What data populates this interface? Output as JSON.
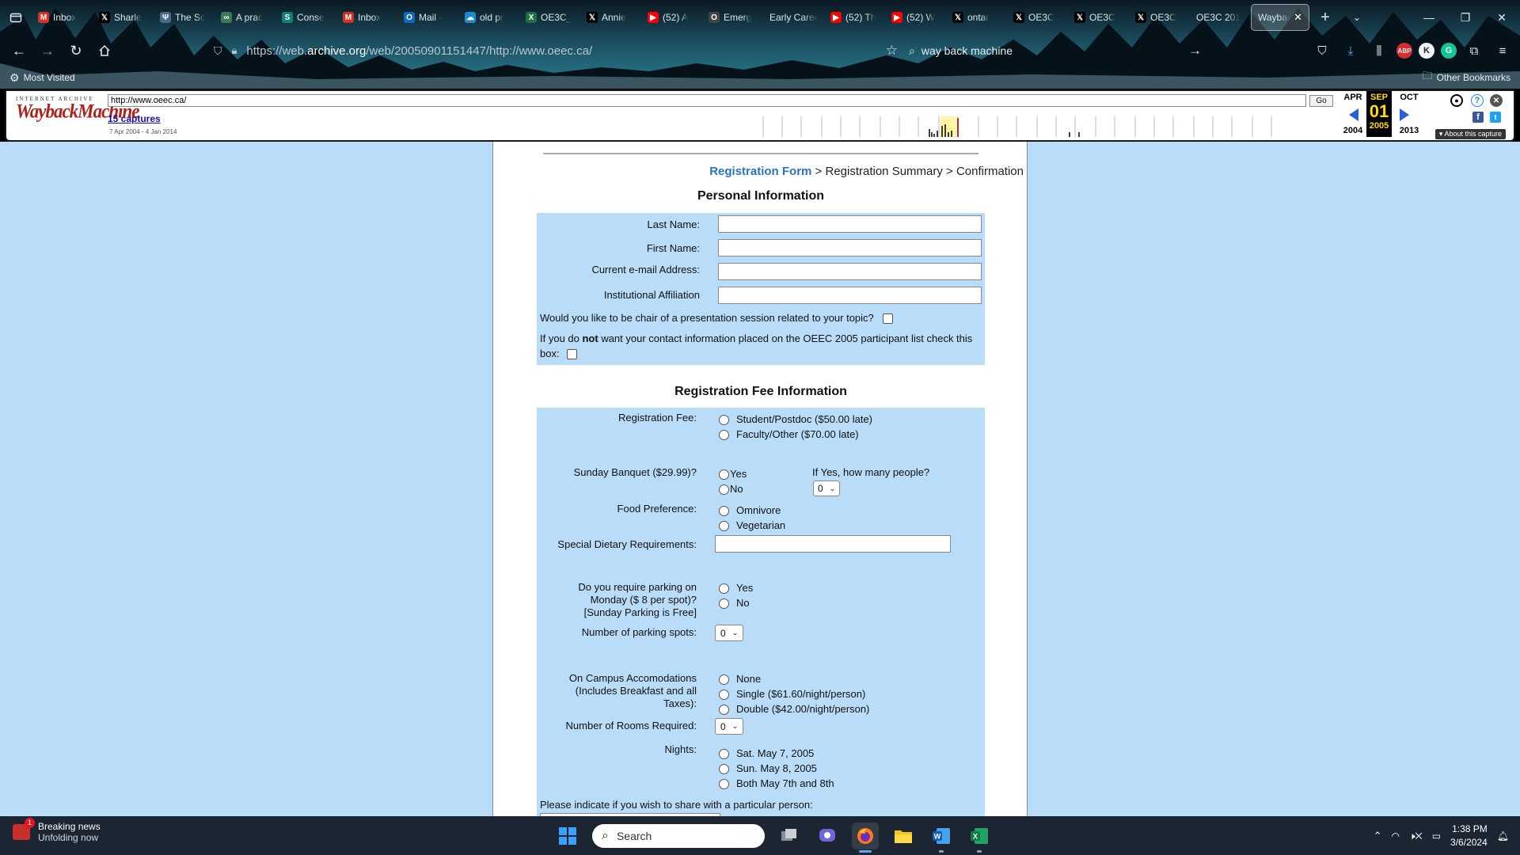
{
  "browser": {
    "tabs": [
      {
        "title": "Inbox",
        "icon": "gmail-icon",
        "color": "#d93025",
        "glyph": "M"
      },
      {
        "title": "Sharle",
        "icon": "x-icon",
        "color": "#000000",
        "glyph": "𝕏"
      },
      {
        "title": "The Sc",
        "icon": "doc-icon",
        "color": "#4b6a87",
        "glyph": "Ψ"
      },
      {
        "title": "A prac",
        "icon": "journal-icon",
        "color": "#3b7a55",
        "glyph": "∞"
      },
      {
        "title": "Conse",
        "icon": "sway-icon",
        "color": "#138078",
        "glyph": "S"
      },
      {
        "title": "Inbox",
        "icon": "gmail-icon",
        "color": "#d93025",
        "glyph": "M"
      },
      {
        "title": "Mail -",
        "icon": "outlook-icon",
        "color": "#0f6cbd",
        "glyph": "O"
      },
      {
        "title": "old pr",
        "icon": "onedrive-icon",
        "color": "#1a8ad4",
        "glyph": "☁"
      },
      {
        "title": "OE3C_",
        "icon": "excel-icon",
        "color": "#1d7044",
        "glyph": "X"
      },
      {
        "title": "Annie",
        "icon": "x-icon",
        "color": "#000000",
        "glyph": "𝕏"
      },
      {
        "title": "(52) A",
        "icon": "youtube-icon",
        "color": "#ff0000",
        "glyph": "▶"
      },
      {
        "title": "Emerg",
        "icon": "generic-icon",
        "color": "#444444",
        "glyph": "O"
      },
      {
        "title": "Early Caree",
        "icon": "none",
        "color": "transparent",
        "glyph": ""
      },
      {
        "title": "(52) Th",
        "icon": "youtube-icon",
        "color": "#ff0000",
        "glyph": "▶"
      },
      {
        "title": "(52) W",
        "icon": "youtube-icon",
        "color": "#ff0000",
        "glyph": "▶"
      },
      {
        "title": "ontar",
        "icon": "x-icon",
        "color": "#000000",
        "glyph": "𝕏"
      },
      {
        "title": "OE3C",
        "icon": "x-icon",
        "color": "#000000",
        "glyph": "𝕏"
      },
      {
        "title": "OE3C",
        "icon": "x-icon",
        "color": "#000000",
        "glyph": "𝕏"
      },
      {
        "title": "OE3C",
        "icon": "x-icon",
        "color": "#000000",
        "glyph": "𝕏"
      },
      {
        "title": "OE3C 201",
        "icon": "none",
        "color": "transparent",
        "glyph": ""
      },
      {
        "title": "Waybac",
        "icon": "none",
        "color": "transparent",
        "glyph": "",
        "active": true
      }
    ],
    "url_prefix": "https://web.",
    "url_domain": "archive.org",
    "url_rest": "/web/20050901151447/http://www.oeec.ca/",
    "search_text": "way back machine",
    "bookmarks": {
      "most_visited": "Most Visited",
      "other": "Other Bookmarks"
    }
  },
  "wayback": {
    "logo_top": "INTERNET ARCHIVE",
    "logo_main": "WaybackMachine",
    "url_value": "http://www.oeec.ca/",
    "go_label": "Go",
    "captures": "15 captures",
    "range": "7 Apr 2004 - 4 Jan 2014",
    "months": {
      "prev": "APR",
      "cur": "SEP",
      "next": "OCT"
    },
    "day": "01",
    "years": {
      "prev": "2004",
      "cur": "2005",
      "next": "2013"
    },
    "about": "▾ About this capture"
  },
  "form": {
    "breadcrumb": {
      "current": "Registration Form",
      "rest": " > Registration Summary > Confirmation"
    },
    "personal_title": "Personal Information",
    "last_name": "Last Name:",
    "first_name": "First Name:",
    "email": "Current e-mail Address:",
    "affiliation": "Institutional Affiliation",
    "chair_q": "Would you like to be chair of a presentation session related to your topic?",
    "contact_q_pre": "If you do ",
    "contact_q_bold": "not",
    "contact_q_post": " want your contact information placed on the OEEC 2005 participant list check this",
    "contact_q_end": "box:",
    "fee_title": "Registration Fee Information",
    "reg_fee": "Registration Fee:",
    "reg_opt1": "Student/Postdoc ($50.00 late)",
    "reg_opt2": "Faculty/Other ($70.00 late)",
    "banquet": "Sunday Banquet ($29.99)?",
    "yes": "Yes",
    "no": "No",
    "how_many": "If Yes, how many people?",
    "sel_zero": "0",
    "food": "Food Preference:",
    "omnivore": "Omnivore",
    "vegetarian": "Vegetarian",
    "dietary": "Special Dietary Requirements:",
    "parking_l1": "Do you require parking on",
    "parking_l2": "Monday ($ 8 per spot)?",
    "parking_l3": "[Sunday Parking is Free]",
    "parking_spots": "Number of parking spots:",
    "acc_l1": "On Campus Accomodations",
    "acc_l2": "(Includes Breakfast and all",
    "acc_l3": "Taxes):",
    "acc_none": "None",
    "acc_single": "Single ($61.60/night/person)",
    "acc_double": "Double ($42.00/night/person)",
    "rooms": "Number of Rooms Required:",
    "nights": "Nights:",
    "night1": "Sat. May 7, 2005",
    "night2": "Sun. May 8, 2005",
    "night3": "Both May 7th and 8th",
    "share": "Please indicate if you wish to share with a particular person:"
  },
  "taskbar": {
    "news_t1": "Breaking news",
    "news_t2": "Unfolding now",
    "news_badge": "1",
    "search": "Search",
    "time": "1:38 PM",
    "date": "3/6/2024"
  }
}
